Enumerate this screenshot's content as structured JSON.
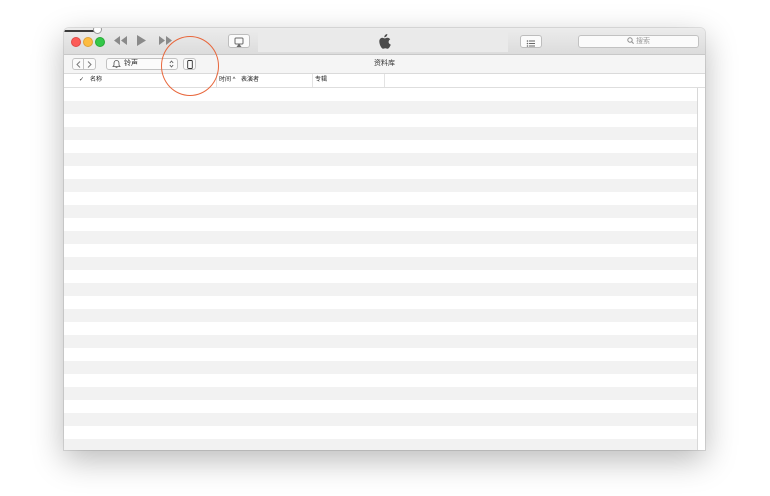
{
  "window": {
    "traffic_lights": [
      "close",
      "minimize",
      "zoom"
    ],
    "colors": {
      "close": "#fc5b57",
      "minimize": "#fdbc40",
      "zoom": "#34c84a"
    }
  },
  "player": {
    "icons": [
      "rewind-icon",
      "play-icon",
      "fast-forward-icon",
      "volume-slider",
      "airplay-icon",
      "apple-logo",
      "list-view-icon"
    ],
    "volume_level": 0.8
  },
  "search": {
    "placeholder": "搜索"
  },
  "toolbar": {
    "media_kind": "铃声",
    "title": "资料库"
  },
  "columns": [
    {
      "label": "名称",
      "checked": true
    },
    {
      "label": "时间",
      "sorted": "ascending"
    },
    {
      "label": "表演者"
    },
    {
      "label": "专辑"
    }
  ],
  "annotation": {
    "color": "#e8673c",
    "target": "device-button"
  }
}
